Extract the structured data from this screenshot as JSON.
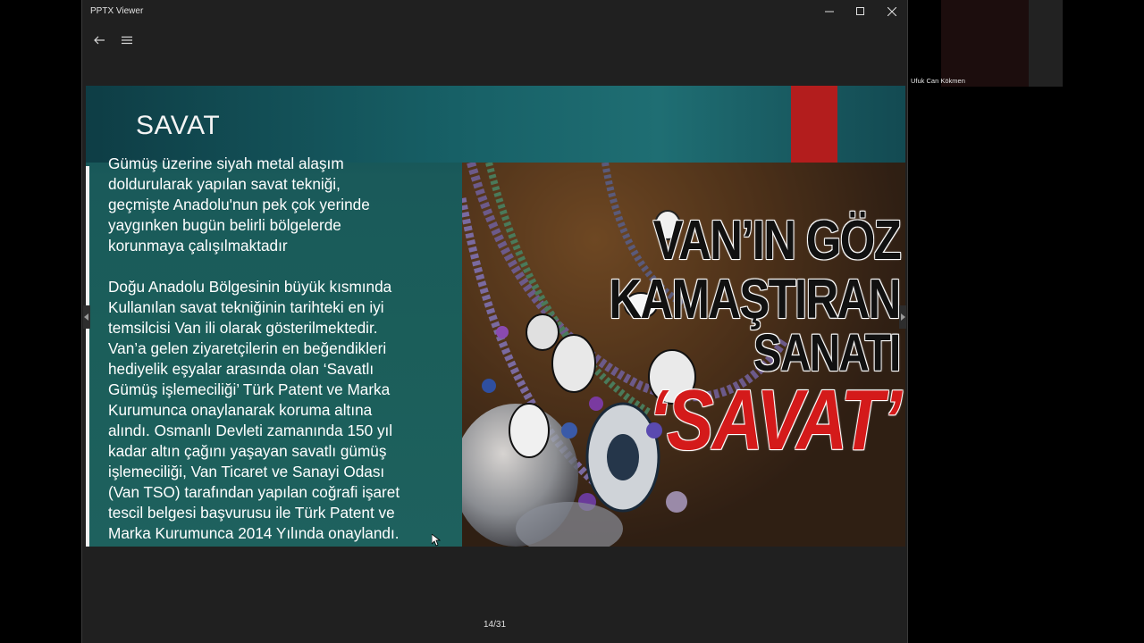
{
  "window": {
    "title": "PPTX Viewer"
  },
  "toolbar": {
    "back_icon": "arrow-left-icon",
    "menu_icon": "hamburger-menu-icon"
  },
  "slide": {
    "title": "SAVAT",
    "paragraph_1": "Gümüş üzerine siyah metal alaşım\ndoldurularak yapılan savat tekniği,\ngeçmişte Anadolu'nun pek çok yerinde\n yaygınken bugün belirli bölgelerde\nkorunmaya çalışılmaktadır",
    "paragraph_2": "Doğu Anadolu Bölgesinin büyük kısmında\nKullanılan savat tekniğinin tarihteki en iyi\ntemsilcisi Van ili olarak gösterilmektedir.\nVan’a gelen ziyaretçilerin en beğendikleri\nhediyelik eşyalar arasında olan ‘Savatlı\nGümüş işlemeciliği’ Türk Patent ve Marka\nKurumunca onaylanarak koruma altına\nalındı. Osmanlı Devleti zamanında 150 yıl\nkadar altın çağını yaşayan savatlı gümüş\nişlemeciliği, Van Ticaret ve Sanayi Odası\n(Van TSO) tarafından yapılan coğrafi işaret\ntescil belgesi başvurusu ile Türk Patent ve\nMarka Kurumunca 2014 Yılında onaylandı.",
    "image_headline": {
      "line_1": "VAN’IN GÖZ",
      "line_2": "KAMAŞTIRAN",
      "line_3": "SANATI",
      "line_4": "‘SAVAT’"
    }
  },
  "pager": {
    "counter": "14/31"
  },
  "meeting": {
    "participant_name": "Ufuk Can Kökmen"
  },
  "colors": {
    "slide_bg": "#1b5e5a",
    "accent_red": "#b31d1d",
    "headline_red": "#d41a1a"
  }
}
